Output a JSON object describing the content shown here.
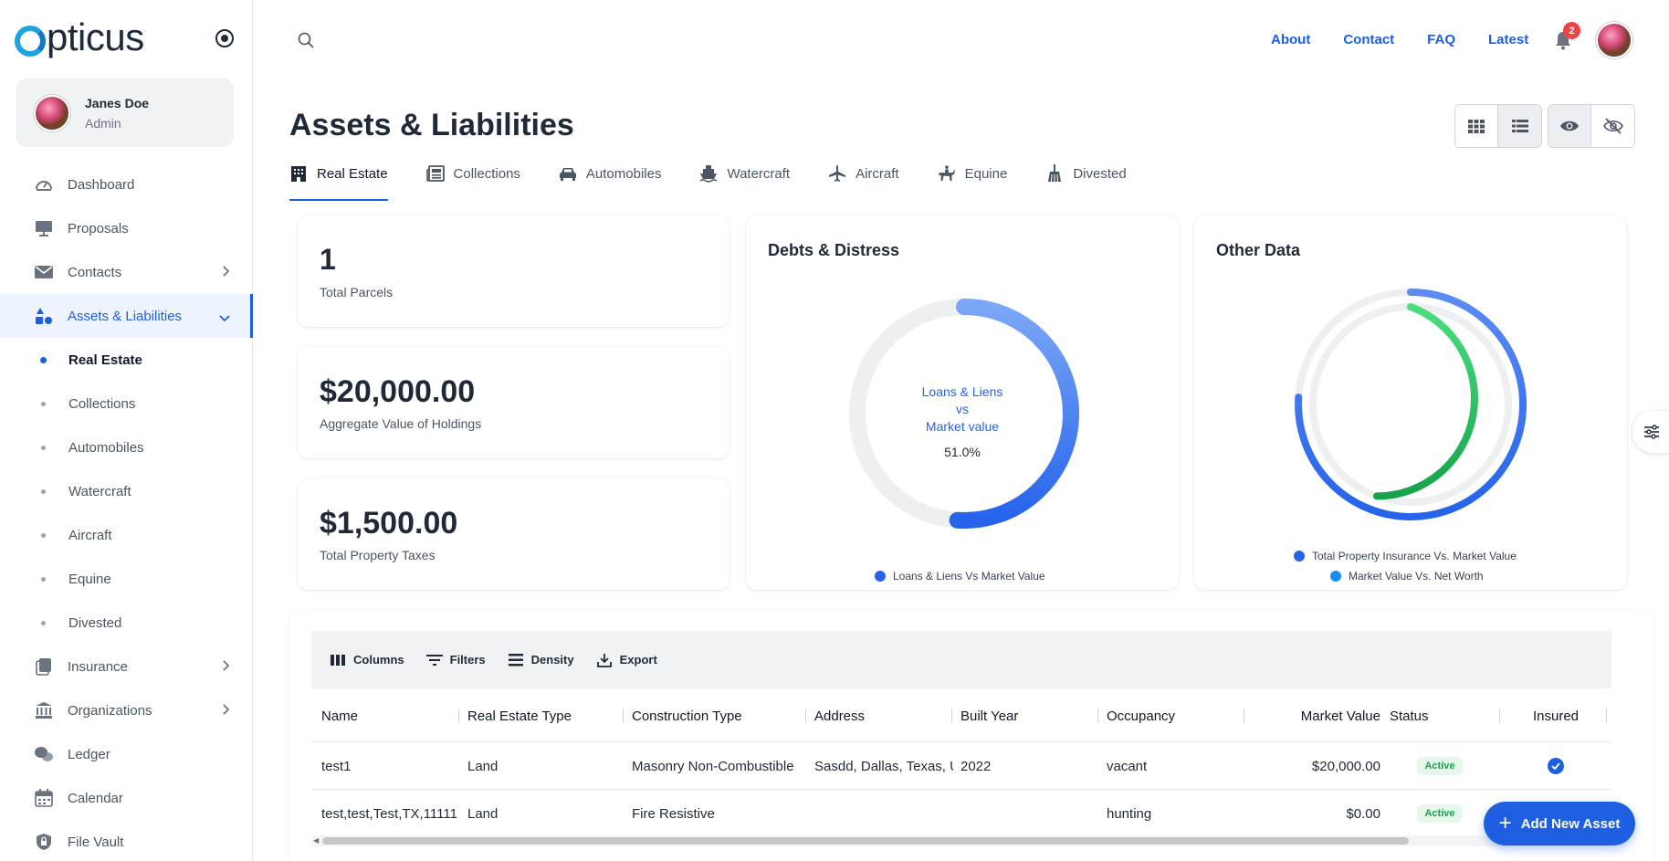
{
  "app": {
    "logo_text": "pticus"
  },
  "user": {
    "name": "Janes Doe",
    "role": "Admin"
  },
  "sidebar": {
    "items": [
      {
        "label": "Dashboard",
        "icon": "dashboard-gauge-icon"
      },
      {
        "label": "Proposals",
        "icon": "presentation-icon"
      },
      {
        "label": "Contacts",
        "icon": "envelope-icon",
        "has_children": true
      },
      {
        "label": "Assets & Liabilities",
        "icon": "shapes-icon",
        "has_children": true,
        "expanded": true
      },
      {
        "label": "Insurance",
        "icon": "copy-icon",
        "has_children": true
      },
      {
        "label": "Organizations",
        "icon": "bank-icon",
        "has_children": true
      },
      {
        "label": "Ledger",
        "icon": "chat-bubbles-icon"
      },
      {
        "label": "Calendar",
        "icon": "calendar-icon"
      },
      {
        "label": "File Vault",
        "icon": "shield-lock-icon"
      }
    ],
    "subitems": [
      "Real Estate",
      "Collections",
      "Automobiles",
      "Watercraft",
      "Aircraft",
      "Equine",
      "Divested"
    ]
  },
  "topnav": {
    "about": "About",
    "contact": "Contact",
    "faq": "FAQ",
    "latest": "Latest",
    "notification_count": "2"
  },
  "page": {
    "title": "Assets & Liabilities"
  },
  "tabs": [
    {
      "label": "Real Estate",
      "icon": "building-icon"
    },
    {
      "label": "Collections",
      "icon": "newspaper-icon"
    },
    {
      "label": "Automobiles",
      "icon": "car-icon"
    },
    {
      "label": "Watercraft",
      "icon": "ship-icon"
    },
    {
      "label": "Aircraft",
      "icon": "airplane-icon"
    },
    {
      "label": "Equine",
      "icon": "horse-rider-icon"
    },
    {
      "label": "Divested",
      "icon": "broom-icon"
    }
  ],
  "stats": [
    {
      "value": "1",
      "label": "Total Parcels"
    },
    {
      "value": "$20,000.00",
      "label": "Aggregate Value of Holdings"
    },
    {
      "value": "$1,500.00",
      "label": "Total Property Taxes"
    }
  ],
  "debts": {
    "title": "Debts & Distress",
    "center_line1": "Loans & Liens",
    "center_line2": "vs",
    "center_line3": "Market value",
    "center_value": "51.0%",
    "legend": "Loans & Liens Vs Market Value",
    "percent": 51.0,
    "color": "#2563eb"
  },
  "other": {
    "title": "Other Data",
    "legend1": "Total Property Insurance Vs. Market Value",
    "legend2": "Market Value Vs. Net Worth",
    "color1": "#2563eb",
    "color2": "#16a34a"
  },
  "toolbar": {
    "columns": "Columns",
    "filters": "Filters",
    "density": "Density",
    "export": "Export"
  },
  "table": {
    "headers": [
      "Name",
      "Real Estate Type",
      "Construction Type",
      "Address",
      "Built Year",
      "Occupancy",
      "Market Value",
      "Status",
      "Insured"
    ],
    "rows": [
      {
        "name": "test1",
        "type": "Land",
        "construction": "Masonry Non-Combustible",
        "address": "Sasdd, Dallas, Texas, US",
        "year": "2022",
        "occupancy": "vacant",
        "value": "$20,000.00",
        "status": "Active",
        "insured": true
      },
      {
        "name": "test,test,Test,TX,11111",
        "type": "Land",
        "construction": "Fire Resistive",
        "address": "",
        "year": "",
        "occupancy": "hunting",
        "value": "$0.00",
        "status": "Active",
        "insured": false
      }
    ]
  },
  "fab": {
    "label": "Add New Asset"
  }
}
